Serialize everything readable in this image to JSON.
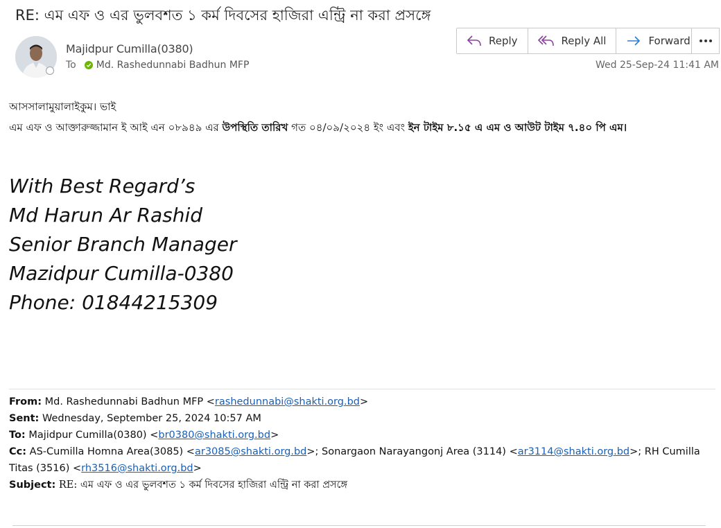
{
  "message": {
    "subject": "RE: এম এফ ও এর ভুলবশত ১ কর্ম দিবসের হাজিরা এন্ট্রি না করা প্রসঙ্গে",
    "sender": "Majidpur Cumilla(0380)",
    "to_label": "To",
    "recipient": "Md. Rashedunnabi Badhun MFP",
    "date": "Wed 25-Sep-24 11:41 AM"
  },
  "toolbar": {
    "reply": "Reply",
    "reply_all": "Reply All",
    "forward": "Forward"
  },
  "body": {
    "greeting": "আসসালামুয়ালাইকুম। ভাই",
    "para_part1": "এম এফ ও আক্তারুজ্জামান ই আই এন ০৮৯৪৯ এর ",
    "para_bold1": "উপস্থিতি তারিখ",
    "para_part2": " গত ০৪/০৯/২০২৪ ইং এবং ",
    "para_bold2": "ইন টাইম ৮.১৫ এ এম ও আউট টাইম ৭.৪০ পি এম।"
  },
  "signature": {
    "line1": "With Best Regard’s",
    "line2": "Md Harun Ar Rashid",
    "line3": "Senior Branch Manager",
    "line4": "Mazidpur Cumilla-0380",
    "line5": "Phone: 01844215309"
  },
  "original": {
    "from_label": "From:",
    "from_name": " Md. Rashedunnabi Badhun MFP <",
    "from_email": "rashedunnabi@shakti.org.bd",
    "sent_label": "Sent:",
    "sent_value": " Wednesday, September 25, 2024 10:57 AM",
    "to_label": "To:",
    "to_name": " Majidpur Cumilla(0380) <",
    "to_email": "br0380@shakti.org.bd",
    "cc_label": "Cc:",
    "cc_name1": " AS-Cumilla Homna Area(3085) <",
    "cc_email1": "ar3085@shakti.org.bd",
    "cc_name2": ">; Sonargaon Narayangonj Area (3114) <",
    "cc_email2": "ar3114@shakti.org.bd",
    "cc_name3": ">; RH Cumilla Titas (3516) <",
    "cc_email3": "rh3516@shakti.org.bd",
    "subject_label": "Subject:",
    "subject_value": " RE: এম এফ ও এর ভুলবশত ১ কর্ম দিবসের হাজিরা এন্ট্রি না করা প্রসঙ্গে"
  },
  "colors": {
    "icon_purple": "#8a3f9e",
    "icon_blue": "#2b7cd3",
    "link": "#1a5fb4",
    "presence_green": "#6bb700"
  }
}
